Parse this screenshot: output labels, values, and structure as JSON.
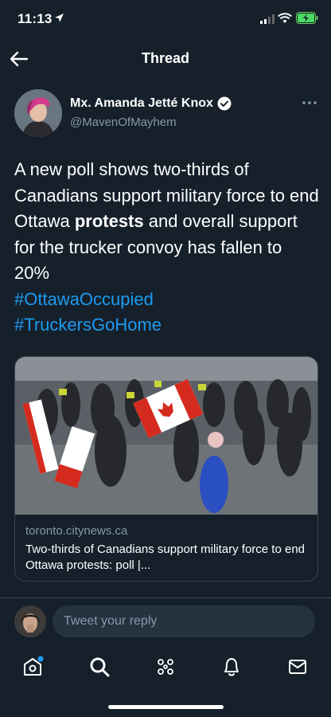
{
  "status_bar": {
    "time": "11:13",
    "battery_charging": true,
    "icons": [
      "location-arrow-icon",
      "cellular-signal-icon",
      "wifi-icon",
      "battery-charging-icon"
    ]
  },
  "header": {
    "title": "Thread",
    "back_icon": "arrow-left-icon"
  },
  "tweet": {
    "author_name": "Mx. Amanda Jetté Knox",
    "author_verified": true,
    "author_handle": "@MavenOfMayhem",
    "more_icon": "more-horizontal-icon",
    "text_before_bold": "A new poll shows two-thirds of Canadians support military force to end Ottawa ",
    "text_bold": "protests",
    "text_after_bold": " and overall support for the trucker convoy has fallen to 20%",
    "hashtags": [
      "#OttawaOccupied",
      "#TruckersGoHome"
    ]
  },
  "link_card": {
    "domain": "toronto.citynews.ca",
    "title": "Two-thirds of Canadians support military force to end Ottawa protests: poll |..."
  },
  "reply": {
    "placeholder": "Tweet your reply"
  },
  "tabbar": {
    "items": [
      {
        "name": "home",
        "icon": "home-icon",
        "has_notification_dot": true
      },
      {
        "name": "search",
        "icon": "search-icon",
        "active": true
      },
      {
        "name": "spaces",
        "icon": "spaces-icon"
      },
      {
        "name": "notifications",
        "icon": "bell-icon"
      },
      {
        "name": "messages",
        "icon": "envelope-icon"
      }
    ]
  },
  "colors": {
    "background": "#15202b",
    "accent": "#1d9bf0",
    "secondary_text": "#8899a6",
    "border": "#38444d"
  }
}
